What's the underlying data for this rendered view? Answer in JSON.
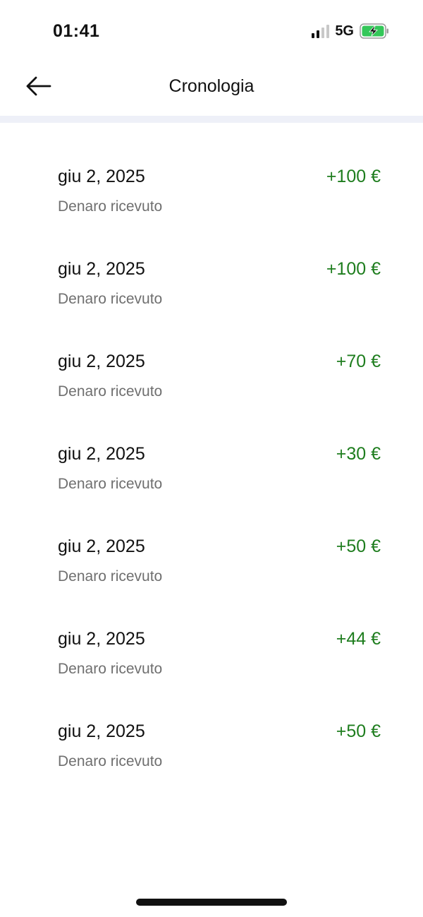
{
  "status_bar": {
    "time": "01:41",
    "network": "5G",
    "signal_icon": "signal-bars-icon",
    "battery_icon": "battery-charging-icon",
    "battery_color": "#34c759"
  },
  "header": {
    "title": "Cronologia",
    "back_icon": "arrow-left-icon"
  },
  "colors": {
    "amount_positive": "#1e7d1e",
    "secondary_text": "#6f6f6f",
    "divider": "#eef0f8"
  },
  "transactions": [
    {
      "date": "giu 2, 2025",
      "description": "Denaro ricevuto",
      "amount": "+100 €"
    },
    {
      "date": "giu 2, 2025",
      "description": "Denaro ricevuto",
      "amount": "+100 €"
    },
    {
      "date": "giu 2, 2025",
      "description": "Denaro ricevuto",
      "amount": "+70 €"
    },
    {
      "date": "giu 2, 2025",
      "description": "Denaro ricevuto",
      "amount": "+30 €"
    },
    {
      "date": "giu 2, 2025",
      "description": "Denaro ricevuto",
      "amount": "+50 €"
    },
    {
      "date": "giu 2, 2025",
      "description": "Denaro ricevuto",
      "amount": "+44 €"
    },
    {
      "date": "giu 2, 2025",
      "description": "Denaro ricevuto",
      "amount": "+50 €"
    }
  ]
}
